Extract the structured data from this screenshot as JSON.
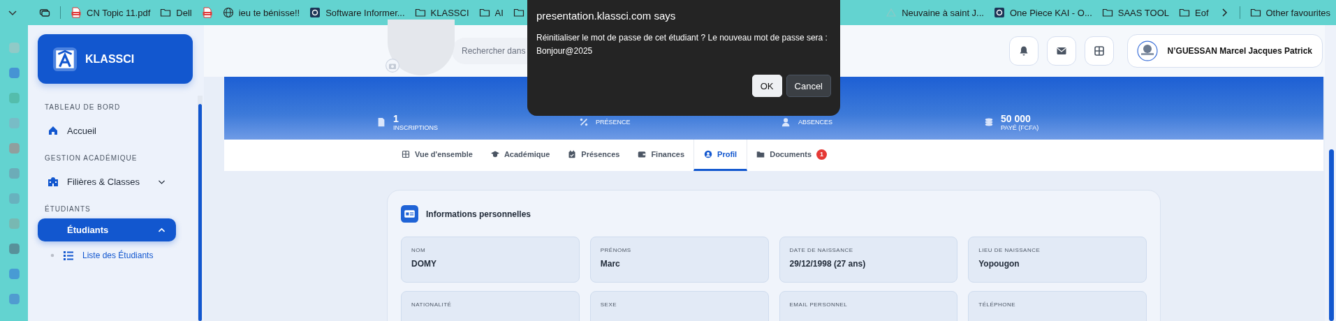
{
  "bookmarks_bar": {
    "left": [
      {
        "kind": "pdf",
        "label": "CN Topic 11.pdf"
      },
      {
        "kind": "folder",
        "label": "Dell"
      },
      {
        "kind": "pdf"
      },
      {
        "kind": "web",
        "label": "ieu te bénisse!!"
      },
      {
        "kind": "app",
        "label": "Software Informer..."
      },
      {
        "kind": "folder",
        "label": "KLASSCI"
      },
      {
        "kind": "folder",
        "label": "AI"
      },
      {
        "kind": "folder"
      }
    ],
    "right": [
      {
        "kind": "faint",
        "label": "Neuvaine à saint J..."
      },
      {
        "kind": "app",
        "label": "One Piece KAI - O..."
      },
      {
        "kind": "folder",
        "label": "SAAS TOOL"
      },
      {
        "kind": "folder",
        "label": "Eof"
      }
    ],
    "other": {
      "label": "Other favourites"
    }
  },
  "sidebar": {
    "brand": "KLASSCI",
    "sections": [
      {
        "heading": "TABLEAU DE BORD",
        "items": [
          {
            "label": "Accueil",
            "selected": false
          }
        ]
      },
      {
        "heading": "GESTION ACADÉMIQUE",
        "items": [
          {
            "label": "Filières & Classes",
            "selected": false,
            "expanded": false
          }
        ]
      },
      {
        "heading": "ÉTUDIANTS",
        "items": [
          {
            "label": "Étudiants",
            "selected": true,
            "expanded": true,
            "children": [
              {
                "label": "Liste des Étudiants",
                "selected": false
              }
            ]
          }
        ]
      }
    ]
  },
  "header": {
    "search": {
      "placeholder": "Rechercher dans"
    },
    "user": {
      "name": "N’GUESSAN Marcel Jacques Patrick"
    }
  },
  "stats": [
    {
      "value": "1",
      "label": "INSCRIPTIONS"
    },
    {
      "label": "PRÉSENCE"
    },
    {
      "label": "ABSENCES"
    },
    {
      "value": "50 000",
      "label": "PAYÉ (FCFA)"
    }
  ],
  "tabs": [
    {
      "label": "Vue d'ensemble",
      "selected": false
    },
    {
      "label": "Académique",
      "selected": false
    },
    {
      "label": "Présences",
      "selected": false
    },
    {
      "label": "Finances",
      "selected": false
    },
    {
      "label": "Profil",
      "selected": true
    },
    {
      "label": "Documents",
      "selected": false,
      "badge": "1"
    }
  ],
  "card": {
    "title": "Informations personnelles",
    "fields": [
      {
        "label": "NOM",
        "value": "DOMY"
      },
      {
        "label": "PRÉNOMS",
        "value": "Marc"
      },
      {
        "label": "DATE DE NAISSANCE",
        "value": "29/12/1998 (27 ans)"
      },
      {
        "label": "LIEU DE NAISSANCE",
        "value": "Yopougon"
      },
      {
        "label": "NATIONALITÉ"
      },
      {
        "label": "SEXE"
      },
      {
        "label": "EMAIL PERSONNEL"
      },
      {
        "label": "TÉLÉPHONE"
      }
    ]
  },
  "dialog": {
    "title": "presentation.klassci.com says",
    "message": "Réinitialiser le mot de passe de cet étudiant ? Le nouveau mot de passe sera : Bonjour@2025",
    "buttons": [
      {
        "label": "OK",
        "primary": true
      },
      {
        "label": "Cancel",
        "primary": false
      }
    ]
  }
}
